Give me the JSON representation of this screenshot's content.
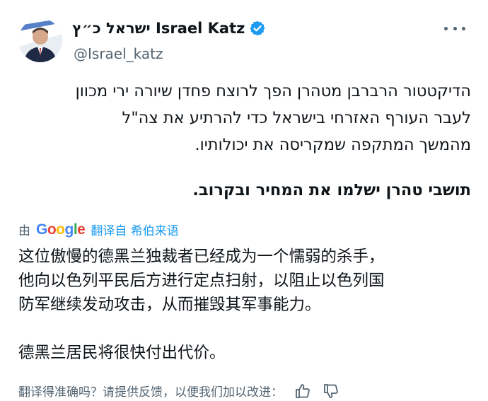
{
  "author": {
    "display_name": "ישראל כ״ץ Israel Katz",
    "handle": "@Israel_katz",
    "verified_color": "#1d9bf0"
  },
  "tweet": {
    "lines": [
      "הדיקטטור הרברבן מטהרן הפך לרוצח פחדן שיורה ירי מכוון",
      "לעבר העורף האזרחי בישראל כדי להרתיע את צה\"ל",
      "מהמשך המתקפה שמקריסה את יכולותיו."
    ],
    "last_line": "תושבי טהרן ישלמו את המחיר ובקרוב."
  },
  "translation": {
    "by_label": "由",
    "google_letters": [
      {
        "ch": "G",
        "color": "#4285f4"
      },
      {
        "ch": "o",
        "color": "#ea4335"
      },
      {
        "ch": "o",
        "color": "#fbbc05"
      },
      {
        "ch": "g",
        "color": "#4285f4"
      },
      {
        "ch": "l",
        "color": "#34a853"
      },
      {
        "ch": "e",
        "color": "#ea4335"
      }
    ],
    "translated_from": "翻译自 希伯来语",
    "lines": [
      "这位傲慢的德黑兰独裁者已经成为一个懦弱的杀手，",
      "他向以色列平民后方进行定点扫射，以阻止以色列国",
      "防军继续发动攻击，从而摧毁其军事能力。"
    ],
    "last_line": "德黑兰居民将很快付出代价。"
  },
  "feedback": {
    "prompt": "翻译得准确吗？请提供反馈，以便我们加以改进："
  }
}
